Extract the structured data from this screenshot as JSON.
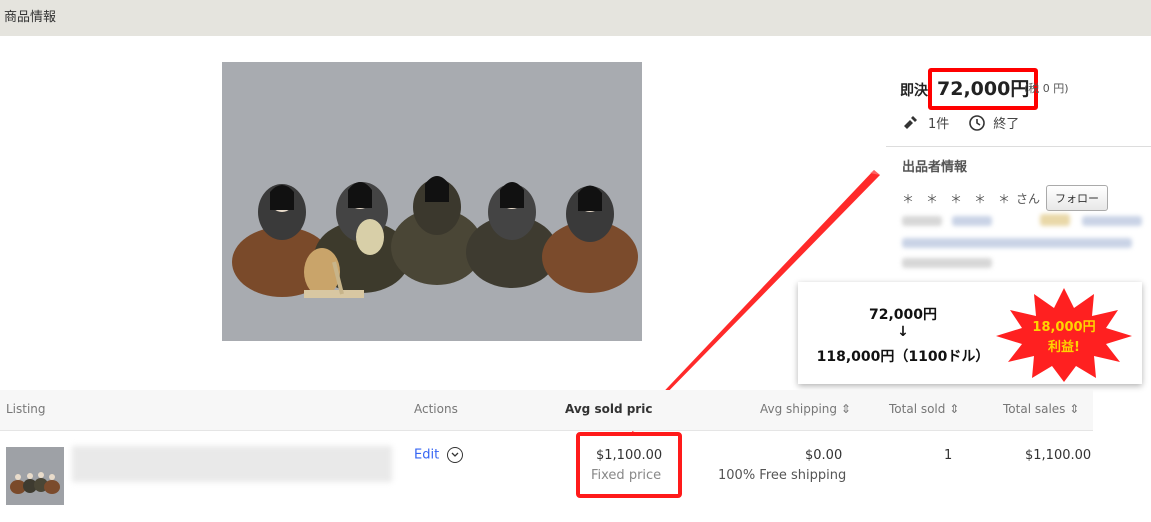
{
  "header": {
    "title": "商品情報"
  },
  "listing": {
    "price_label": "即決",
    "price": "72,000円",
    "tax": "(税 0 円)",
    "bids": "1件",
    "status": "終了",
    "seller_title": "出品者情報",
    "seller_name": "＊　＊　＊　＊　＊",
    "seller_suffix": "さん",
    "follow_label": "フォロー"
  },
  "callout": {
    "line1": "72,000円",
    "arrow": "↓",
    "line2": "118,000円（1100ドル）",
    "burst_line1": "18,000円",
    "burst_line2": "利益!"
  },
  "table": {
    "headers": {
      "listing": "Listing",
      "actions": "Actions",
      "avg_sold_price": "Avg sold pric",
      "avg_shipping": "Avg shipping",
      "total_sold": "Total sold",
      "total_sales": "Total sales"
    },
    "row": {
      "edit": "Edit",
      "avg_sold_price": "$1,100.00",
      "price_type": "Fixed price",
      "avg_shipping": "$0.00",
      "shipping_note": "100% Free shipping",
      "total_sold": "1",
      "total_sales": "$1,100.00"
    }
  },
  "colors": {
    "highlight": "#ff0000",
    "link": "#3665f3",
    "burst": "#ff2020"
  }
}
